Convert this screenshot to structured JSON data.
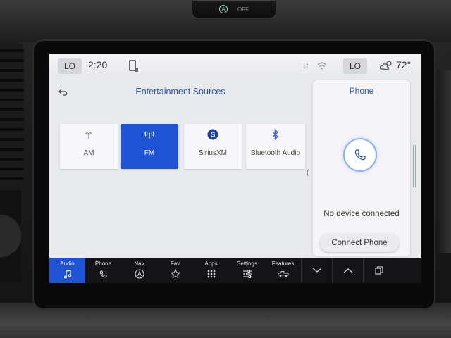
{
  "hardware": {
    "top_switch_label": "OFF"
  },
  "status_bar": {
    "climate_left": "LO",
    "time": "2:20",
    "climate_right": "LO",
    "temperature": "72°"
  },
  "entertainment": {
    "title": "Entertainment Sources",
    "sources": [
      {
        "label": "AM",
        "icon": "radio-antenna-icon",
        "selected": false
      },
      {
        "label": "FM",
        "icon": "radio-broadcast-icon",
        "selected": true
      },
      {
        "label": "SiriusXM",
        "icon": "siriusxm-icon",
        "selected": false
      },
      {
        "label": "Bluetooth Audio",
        "icon": "bluetooth-icon",
        "selected": false
      }
    ],
    "scroll_hint": "("
  },
  "phone_panel": {
    "title": "Phone",
    "status": "No device connected",
    "connect_button": "Connect Phone"
  },
  "nav": {
    "items": [
      {
        "label": "Audio",
        "icon": "music-note-icon",
        "active": true
      },
      {
        "label": "Phone",
        "icon": "phone-icon",
        "active": false
      },
      {
        "label": "Nav",
        "icon": "navigation-icon",
        "active": false
      },
      {
        "label": "Fav",
        "icon": "star-icon",
        "active": false
      },
      {
        "label": "Apps",
        "icon": "apps-grid-icon",
        "active": false
      },
      {
        "label": "Settings",
        "icon": "sliders-icon",
        "active": false
      },
      {
        "label": "Features",
        "icon": "truck-icon",
        "active": false
      }
    ],
    "controls": [
      "chevron-down-icon",
      "chevron-up-icon",
      "screens-icon"
    ]
  },
  "colors": {
    "accent": "#1e53d3",
    "title_blue": "#2c58b7",
    "nav_background": "#141418",
    "screen_background": "#e9eaee"
  }
}
